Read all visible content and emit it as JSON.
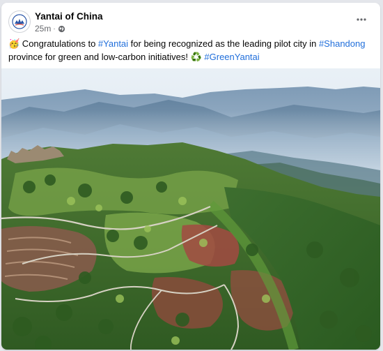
{
  "post": {
    "author": "Yantai of China",
    "timestamp": "25m",
    "separator": "·",
    "audience_icon": "globe-icon",
    "more_icon": "more-options-icon",
    "caption": {
      "emoji": "🥳",
      "text_1": " Congratulations to ",
      "tag_1": "#Yantai",
      "text_2": " for being recognized as the leading pilot city in ",
      "tag_2": "#Shandong",
      "text_3": " province for green and low-carbon initiatives! ",
      "recycle": "♻️",
      "text_4": " ",
      "tag_3": "#GreenYantai"
    },
    "image_icon": "aerial-landscape-photo"
  },
  "colors": {
    "link": "#216fdb",
    "meta": "#65676b",
    "text": "#050505"
  }
}
